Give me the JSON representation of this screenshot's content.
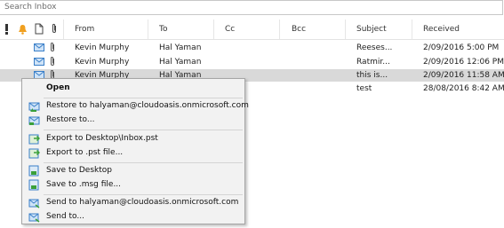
{
  "search": {
    "placeholder": "Search Inbox"
  },
  "columns": {
    "from": "From",
    "to": "To",
    "cc": "Cc",
    "bcc": "Bcc",
    "subject": "Subject",
    "received": "Received"
  },
  "header_icons": [
    "importance-icon",
    "reminder-bell-icon",
    "item-type-icon",
    "attachment-icon"
  ],
  "rows": [
    {
      "from": "Kevin Murphy",
      "to": "Hal Yaman",
      "subject": "Reeses...",
      "received": "2/09/2016 5:00 PM",
      "attachment": true,
      "selected": false
    },
    {
      "from": "Kevin Murphy",
      "to": "Hal Yaman",
      "subject": "Ratmir...",
      "received": "2/09/2016 12:06 PM",
      "attachment": true,
      "selected": false
    },
    {
      "from": "Kevin Murphy",
      "to": "Hal Yaman",
      "subject": "this is...",
      "received": "2/09/2016 11:58 AM",
      "attachment": true,
      "selected": true
    },
    {
      "from": "",
      "to": "",
      "subject": "test",
      "received": "28/08/2016 8:42 AM",
      "attachment": false,
      "selected": false
    }
  ],
  "context_menu": {
    "open": "Open",
    "restore_to_email": "Restore to halyaman@cloudoasis.onmicrosoft.com",
    "restore_to": "Restore to...",
    "export_to_desktop": "Export to Desktop\\Inbox.pst",
    "export_to_pst": "Export to .pst file...",
    "save_to_desktop": "Save to Desktop",
    "save_to_msg": "Save to .msg file...",
    "send_to_email": "Send to halyaman@cloudoasis.onmicrosoft.com",
    "send_to": "Send to..."
  },
  "colors": {
    "selected_row": "#d9d9d9",
    "menu_bg": "#f2f2f2",
    "envelope": "#3a7fc8",
    "bell": "#f0a020"
  }
}
